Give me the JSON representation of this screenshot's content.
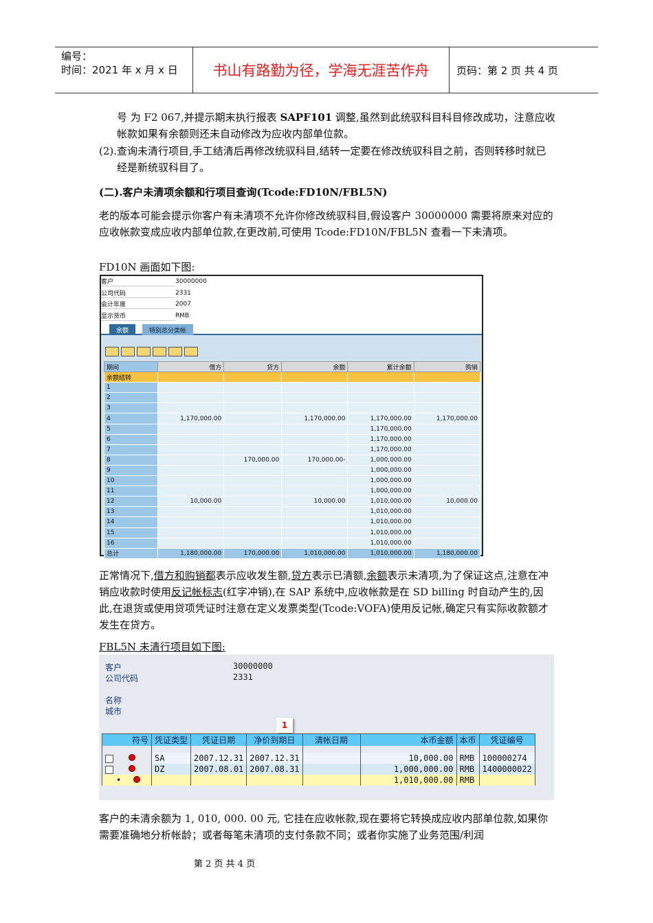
{
  "header": {
    "number_label": "编号：",
    "time": "时间：2021 年 x 月 x 日",
    "motto": "书山有路勤为径，学海无涯苦作舟",
    "page": "页码：第 2 页  共 4 页"
  },
  "paras": {
    "p1a": "号  为 F2 067,并提示期末执行报表 ",
    "p1b": "SAPF101",
    "p1c": " 调整,虽然到此统驭科目科目修改成功，注意应收帐款如果有余额则还未自动修改为应收内部单位款。",
    "p2": "(2).查询未清行项目,手工结清后再修改统驭科目,结转一定要在修改统驭科目之前，否则转移时就已经是新统驭科目了。",
    "heading": "(二).客户未清项余额和行项目查询(Tcode:FD10N/FBL5N)",
    "p3": "老的版本可能会提示你客户有未清项不允许你修改统驭科目,假设客户 30000000 需要将原来对应的应收帐款变成应收内部单位款,在更改前,可使用 Tcode:FD10N/FBL5N 查看一下未清项。",
    "p4": "FD10N 画面如下图:",
    "p5a": "正常情况下,",
    "p5b": "借方和购销都",
    "p5c": "表示应收发生额,",
    "p5d": "贷方",
    "p5e": "表示已清额,",
    "p5f": "余额",
    "p5g": "表示未清项,为了保证这点,注意在冲销应收款时使用",
    "p5h": "反记帐标志",
    "p5i": "(红字冲销),在 SAP 系统中,应收帐款是在 SD billing 时自动产生的,因此,在退货或使用贷项凭证时注意在定义发票类型(Tcode:VOFA)使用反记帐,确定只有实际收款额才发生在贷方。",
    "p6": "FBL5N 未清行项目如下图:",
    "p7": "客户的未清余额为 1, 010, 000. 00 元, 它挂在应收帐款,现在要将它转换成应收内部单位款,如果你需要准确地分析帐龄；或者每笔未清项的支付条款不同；或者你实施了业务范围/利润"
  },
  "fd10n": {
    "fields": [
      [
        "客户",
        "30000000"
      ],
      [
        "公司代码",
        "2331"
      ],
      [
        "会计年度",
        "2007"
      ],
      [
        "显示货币",
        "RMB"
      ]
    ],
    "tabs": [
      "余额",
      "特别总分类帐"
    ],
    "columns": [
      "期间",
      "借方",
      "贷方",
      "余额",
      "累计余额",
      "购销"
    ],
    "rows": [
      [
        "余额结转",
        "",
        "",
        "",
        "",
        ""
      ],
      [
        "1",
        "",
        "",
        "",
        "",
        ""
      ],
      [
        "2",
        "",
        "",
        "",
        "",
        ""
      ],
      [
        "3",
        "",
        "",
        "",
        "",
        ""
      ],
      [
        "4",
        "1,170,000.00",
        "",
        "1,170,000.00",
        "1,170,000.00",
        "1,170,000.00"
      ],
      [
        "5",
        "",
        "",
        "",
        "1,170,000.00",
        ""
      ],
      [
        "6",
        "",
        "",
        "",
        "1,170,000.00",
        ""
      ],
      [
        "7",
        "",
        "",
        "",
        "1,170,000.00",
        ""
      ],
      [
        "8",
        "",
        "170,000.00",
        "170,000.00-",
        "1,000,000.00",
        ""
      ],
      [
        "9",
        "",
        "",
        "",
        "1,000,000.00",
        ""
      ],
      [
        "10",
        "",
        "",
        "",
        "1,000,000.00",
        ""
      ],
      [
        "11",
        "",
        "",
        "",
        "1,000,000.00",
        ""
      ],
      [
        "12",
        "10,000.00",
        "",
        "10,000.00",
        "1,010,000.00",
        "10,000.00"
      ],
      [
        "13",
        "",
        "",
        "",
        "1,010,000.00",
        ""
      ],
      [
        "14",
        "",
        "",
        "",
        "1,010,000.00",
        ""
      ],
      [
        "15",
        "",
        "",
        "",
        "1,010,000.00",
        ""
      ],
      [
        "16",
        "",
        "",
        "",
        "1,010,000.00",
        ""
      ],
      [
        "总计",
        "1,180,000.00",
        "170,000.00",
        "1,010,000.00",
        "1,010,000.00",
        "1,180,000.00"
      ]
    ]
  },
  "fbl5n": {
    "customer_label": "客户",
    "customer": "30000000",
    "company_label": "公司代码",
    "company": "2331",
    "name_label": "名称",
    "city_label": "城市",
    "badge": "1",
    "columns": [
      "符号",
      "凭证类型",
      "凭证日期",
      "净价到期日",
      "清帐日期",
      "本币金额",
      "本币",
      "凭证编号"
    ],
    "rows": [
      [
        "SA",
        "2007.12.31",
        "2007.12.31",
        "",
        "10,000.00",
        "RMB",
        "100000274"
      ],
      [
        "DZ",
        "2007.08.01",
        "2007.08.31",
        "",
        "1,000,000.00",
        "RMB",
        "1400000022"
      ],
      [
        "",
        "",
        "",
        "",
        "1,010,000.00",
        "RMB",
        ""
      ]
    ],
    "total_marker": "•"
  },
  "footer": "第 2 页 共 4 页"
}
